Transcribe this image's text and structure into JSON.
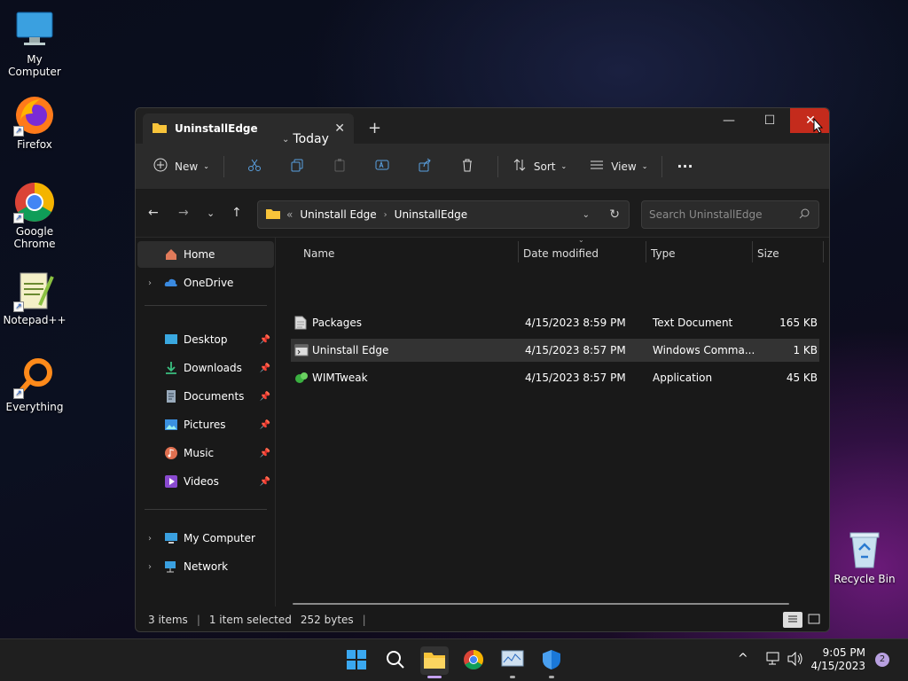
{
  "desktop": {
    "icons": [
      {
        "label": "My Computer",
        "icon": "monitor-icon"
      },
      {
        "label": "Firefox",
        "icon": "firefox-icon"
      },
      {
        "label": "Google Chrome",
        "icon": "chrome-icon"
      },
      {
        "label": "Notepad++",
        "icon": "notepad-icon"
      },
      {
        "label": "Everything",
        "icon": "search-icon"
      },
      {
        "label": "Recycle Bin",
        "icon": "recycle-bin-icon"
      }
    ]
  },
  "window": {
    "tab_title": "UninstallEdge",
    "toolbar": {
      "new_label": "New",
      "sort_label": "Sort",
      "view_label": "View"
    },
    "address": {
      "path": [
        "Uninstall Edge",
        "UninstallEdge"
      ],
      "search_placeholder": "Search UninstallEdge"
    },
    "sidebar": {
      "home": "Home",
      "onedrive": "OneDrive",
      "quick": [
        "Desktop",
        "Downloads",
        "Documents",
        "Pictures",
        "Music",
        "Videos"
      ],
      "my_computer": "My Computer",
      "network": "Network"
    },
    "columns": {
      "name": "Name",
      "date": "Date modified",
      "type": "Type",
      "size": "Size"
    },
    "group_label": "Today",
    "files": [
      {
        "name": "Packages",
        "date": "4/15/2023 8:59 PM",
        "type": "Text Document",
        "size": "165 KB"
      },
      {
        "name": "Uninstall Edge",
        "date": "4/15/2023 8:57 PM",
        "type": "Windows Comma...",
        "size": "1 KB"
      },
      {
        "name": "WIMTweak",
        "date": "4/15/2023 8:57 PM",
        "type": "Application",
        "size": "45 KB"
      }
    ],
    "status": {
      "items": "3 items",
      "selected": "1 item selected",
      "bytes": "252 bytes"
    }
  },
  "taskbar": {
    "time": "9:05 PM",
    "date": "4/15/2023",
    "notif_count": "2"
  }
}
